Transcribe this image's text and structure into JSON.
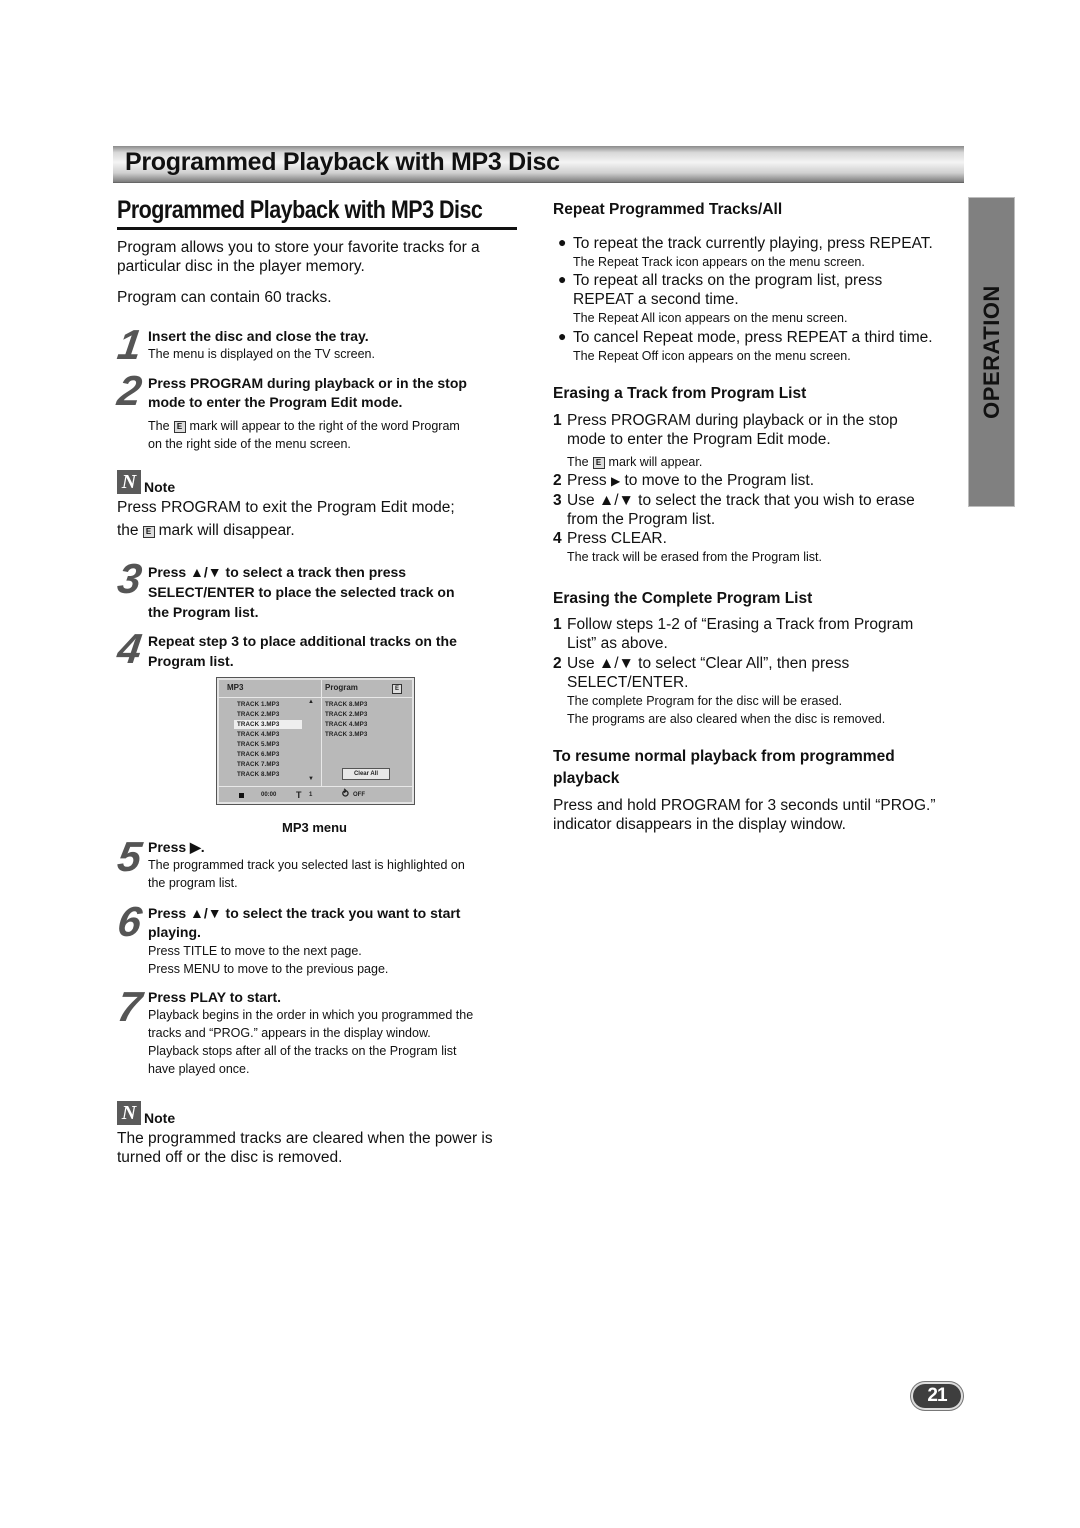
{
  "banner": {
    "title": "Programmed Playback with MP3 Disc"
  },
  "side_tab": {
    "label": "OPERATION"
  },
  "page_number": "21",
  "left": {
    "section_title": "Programmed Playback with MP3 Disc",
    "intro": [
      "Program allows you to store your favorite tracks for a",
      "particular disc in the player memory."
    ],
    "capacity": "Program can contain 60 tracks.",
    "steps": [
      {
        "num": "1",
        "title": [
          "Insert the disc and close the tray."
        ],
        "body": [
          "The menu is displayed on the TV screen."
        ]
      },
      {
        "num": "2",
        "title": [
          "Press PROGRAM during playback or in the stop",
          "mode to enter the Program Edit mode."
        ],
        "body_pre": "The",
        "body_post": "mark will appear to the right of the word Program",
        "body2": "on the right side of the menu screen."
      },
      {
        "num": "3",
        "title": [
          "Press ▲/▼ to select a track then press",
          "SELECT/ENTER to place the selected track on",
          "the Program list."
        ]
      },
      {
        "num": "4",
        "title": [
          "Repeat step 3 to place additional tracks on the",
          "Program list."
        ]
      },
      {
        "num": "5",
        "title": [
          "Press ▶."
        ],
        "body": [
          "The programmed track you selected last is highlighted on",
          "the program list."
        ]
      },
      {
        "num": "6",
        "title": [
          "Press ▲/▼ to select the track you want to start",
          "playing."
        ],
        "body": [
          "Press TITLE to move to the next page.",
          "Press MENU to move to the previous page."
        ]
      },
      {
        "num": "7",
        "title": [
          "Press PLAY to start."
        ],
        "body": [
          "Playback begins in the order in which you programmed the",
          "tracks and “PROG.” appears in the display window.",
          "Playback stops after all of the tracks on the Program list",
          "have played once."
        ]
      }
    ],
    "note1": {
      "label": "Note",
      "line1": "Press PROGRAM to exit the Program Edit mode;",
      "line2_pre": "the",
      "line2_post": "mark will disappear."
    },
    "note2": {
      "label": "Note",
      "lines": [
        "The programmed tracks are cleared when the power is",
        "turned off or the disc is removed."
      ]
    },
    "e_mark": "E"
  },
  "mp3_menu": {
    "caption": "MP3 menu",
    "left_header": "MP3",
    "right_header": "Program",
    "edit_mark": "E",
    "tracks": [
      "TRACK 1.MP3",
      "TRACK 2.MP3",
      "TRACK 3.MP3",
      "TRACK 4.MP3",
      "TRACK 5.MP3",
      "TRACK 6.MP3",
      "TRACK 7.MP3",
      "TRACK 8.MP3"
    ],
    "highlighted_track": "TRACK 3.MP3",
    "program": [
      "TRACK 8.MP3",
      "TRACK 2.MP3",
      "TRACK 4.MP3",
      "TRACK 3.MP3"
    ],
    "clear_all": "Clear All",
    "time": "00:00",
    "title_num": "1",
    "repeat": "OFF",
    "scroll_up": "▲",
    "scroll_down": "▼",
    "title_icon": "T",
    "repeat_icon": "⥁"
  },
  "right": {
    "repeat": {
      "heading": "Repeat Programmed Tracks/All",
      "items": [
        {
          "main": [
            "To repeat the track currently playing, press REPEAT."
          ],
          "sub": "The Repeat Track icon appears on the menu screen."
        },
        {
          "main": [
            "To repeat all tracks on the program list, press",
            "REPEAT a second time."
          ],
          "sub": "The Repeat All icon appears on the menu screen."
        },
        {
          "main": [
            "To cancel Repeat mode, press REPEAT a third time."
          ],
          "sub": "The Repeat Off icon appears on the menu screen."
        }
      ]
    },
    "erase_track": {
      "heading": "Erasing a Track from Program List",
      "s1": [
        "Press PROGRAM during playback or in the stop",
        "mode to enter the Program Edit mode."
      ],
      "s1_sub_pre": "The",
      "s1_sub_post": "mark will appear.",
      "s2_pre": "Press",
      "s2_post": "to move to the Program list.",
      "s3": [
        "Use ▲/▼ to select the track that you wish to erase",
        "from the Program list."
      ],
      "s4": "Press CLEAR.",
      "s4_sub": "The track will be erased from the Program list."
    },
    "erase_all": {
      "heading": "Erasing the Complete Program List",
      "s1": [
        "Follow steps 1-2 of “Erasing a Track from Program",
        "List” as above."
      ],
      "s2": [
        "Use ▲/▼ to select “Clear All”, then press",
        "SELECT/ENTER."
      ],
      "s2_sub": [
        "The complete Program for the disc will be erased.",
        "The programs are also cleared when the disc is removed."
      ]
    },
    "resume": {
      "heading": [
        "To resume normal playback from programmed",
        "playback"
      ],
      "body": [
        "Press and hold PROGRAM for 3 seconds until “PROG.”",
        "indicator disappears in the display window."
      ]
    },
    "numbers": [
      "1",
      "2",
      "3",
      "4"
    ],
    "bullet": "●",
    "play_glyph": "▶"
  }
}
